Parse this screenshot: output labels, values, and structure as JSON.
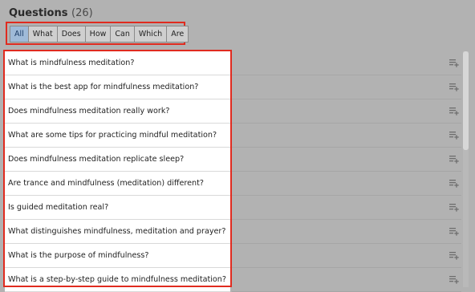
{
  "header": {
    "title": "Questions",
    "count": "(26)"
  },
  "filters": [
    "All",
    "What",
    "Does",
    "How",
    "Can",
    "Which",
    "Are"
  ],
  "active_filter": "All",
  "questions": [
    "What is mindfulness meditation?",
    "What is the best app for mindfulness meditation?",
    "Does mindfulness meditation really work?",
    "What are some tips for practicing mindful meditation?",
    "Does mindfulness meditation replicate sleep?",
    "Are trance and mindfulness (meditation) different?",
    "Is guided meditation real?",
    "What distinguishes mindfulness, meditation and prayer?",
    "What is the purpose of mindfulness?",
    "What is a step-by-step guide to mindfulness meditation?"
  ],
  "row_icon": "add-to-list-icon",
  "colors": {
    "highlight": "#e02b1f",
    "active_chip": "#9fbad8",
    "overlay": "#b2b2b2"
  }
}
